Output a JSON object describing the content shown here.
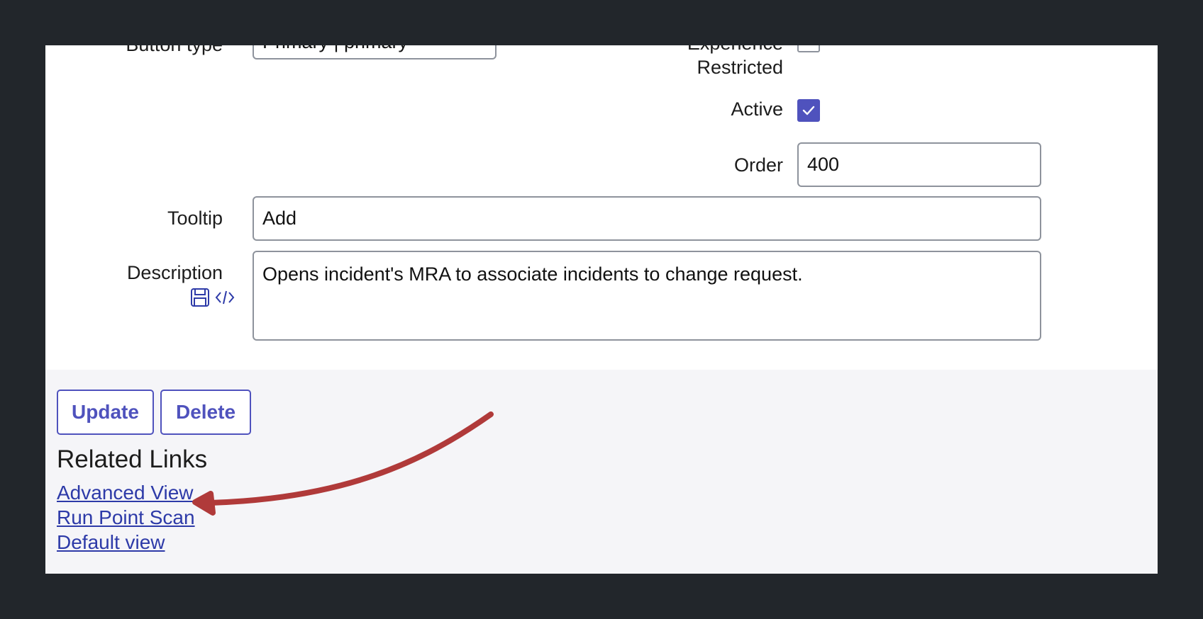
{
  "form": {
    "button_type": {
      "label": "Button type",
      "value": "Primary | primary"
    },
    "experience_restricted": {
      "label_line1": "Experience",
      "label_line2": "Restricted",
      "checked": false
    },
    "active": {
      "label": "Active",
      "checked": true
    },
    "order": {
      "label": "Order",
      "value": "400"
    },
    "tooltip": {
      "label": "Tooltip",
      "value": "Add"
    },
    "description": {
      "label": "Description",
      "value": "Opens incident's MRA to associate incidents to change request."
    }
  },
  "actions": {
    "update_label": "Update",
    "delete_label": "Delete"
  },
  "related_links": {
    "heading": "Related Links",
    "items": [
      {
        "label": "Advanced View"
      },
      {
        "label": "Run Point Scan"
      },
      {
        "label": "Default view"
      }
    ]
  },
  "colors": {
    "accent": "#4f52bd",
    "link": "#2d3aa8",
    "annotation_arrow": "#b03a3a",
    "backdrop": "#22262b"
  },
  "icons": {
    "description_save": "floppy-disk-icon",
    "description_source": "code-icon",
    "active_check": "checkmark-icon"
  }
}
